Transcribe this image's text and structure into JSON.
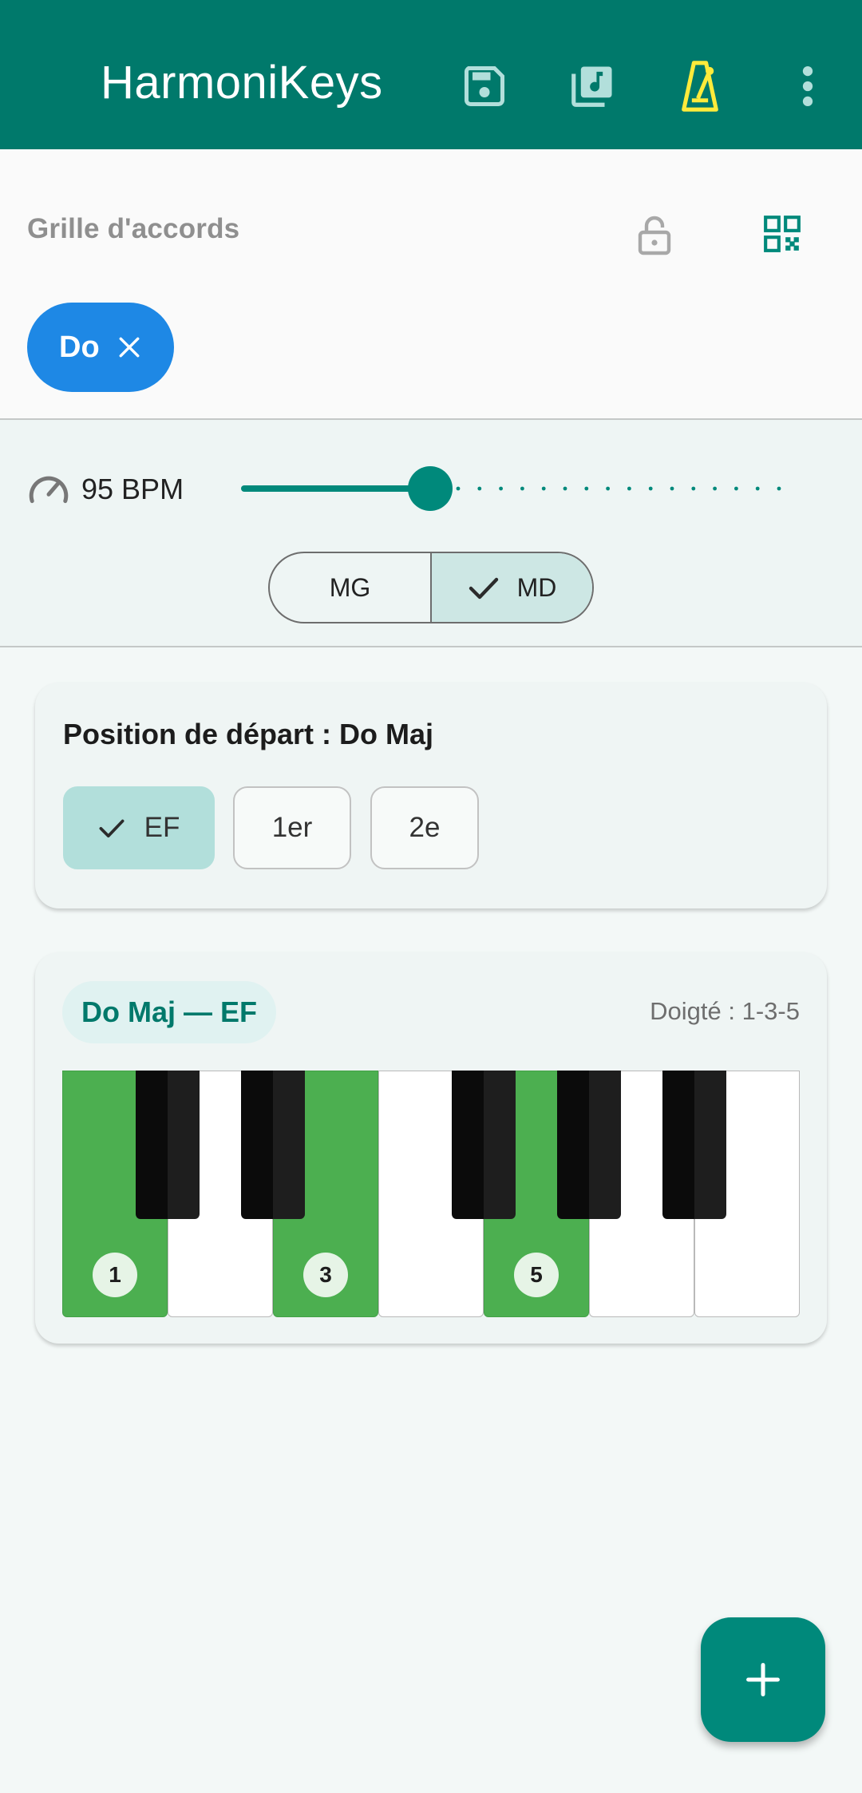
{
  "appbar": {
    "title": "HarmoniKeys",
    "icons": [
      "save-icon",
      "library-music-icon",
      "metronome-icon",
      "more-vert-icon"
    ],
    "metronome_color": "#ffeb3b",
    "background": "#00796b"
  },
  "grid": {
    "label": "Grille d'accords",
    "chips": [
      {
        "label": "Do"
      }
    ],
    "chip_color": "#1e88e5"
  },
  "tempo": {
    "bpm_label": "95 BPM",
    "slider_fraction": 0.35
  },
  "hands": {
    "left": "MG",
    "right": "MD",
    "selected": "MD"
  },
  "start_position": {
    "title": "Position de départ : Do Maj",
    "inversions": [
      {
        "label": "EF",
        "selected": true
      },
      {
        "label": "1er",
        "selected": false
      },
      {
        "label": "2e",
        "selected": false
      }
    ]
  },
  "keyboard": {
    "chord_label": "Do Maj — EF",
    "fingering": "Doigté : 1-3-5",
    "highlight_color": "#4caf50",
    "white_keys": [
      {
        "active": true,
        "finger": "1"
      },
      {
        "active": false,
        "finger": ""
      },
      {
        "active": true,
        "finger": "3"
      },
      {
        "active": false,
        "finger": ""
      },
      {
        "active": true,
        "finger": "5"
      },
      {
        "active": false,
        "finger": ""
      },
      {
        "active": false,
        "finger": ""
      }
    ]
  },
  "fab": {
    "icon": "plus-icon"
  }
}
